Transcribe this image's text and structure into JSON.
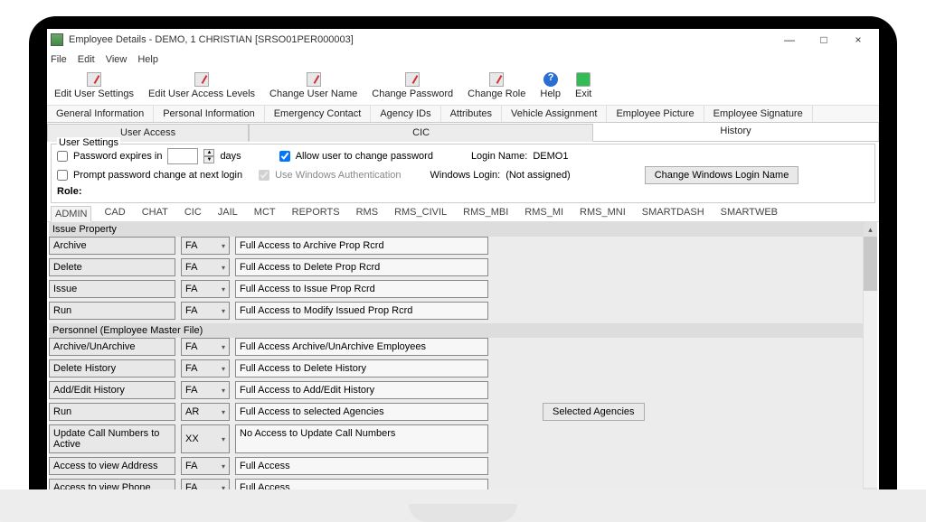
{
  "window": {
    "title": "Employee Details - DEMO, 1 CHRISTIAN [SRSO01PER000003]",
    "minimize": "—",
    "maximize": "□",
    "close": "×"
  },
  "menubar": {
    "items": [
      "File",
      "Edit",
      "View",
      "Help"
    ]
  },
  "toolbar": {
    "items": [
      {
        "label": "Edit User Settings"
      },
      {
        "label": "Edit User Access Levels"
      },
      {
        "label": "Change User Name"
      },
      {
        "label": "Change Password"
      },
      {
        "label": "Change Role"
      },
      {
        "label": "Help"
      },
      {
        "label": "Exit"
      }
    ]
  },
  "primary_tabs": [
    "General Information",
    "Personal Information",
    "Emergency Contact",
    "Agency IDs",
    "Attributes",
    "Vehicle Assignment",
    "Employee Picture",
    "Employee Signature"
  ],
  "secondary_tabs": {
    "left": "User Access",
    "mid": "CIC",
    "right": "History"
  },
  "user_settings": {
    "legend": "User Settings",
    "pw_expires_label_a": "Password expires in",
    "pw_expires_label_b": "days",
    "pw_expires_value": "",
    "allow_change_pw": "Allow user to change password",
    "prompt_change": "Prompt password change at next login",
    "win_auth": "Use Windows Authentication",
    "login_name_label": "Login Name:",
    "login_name_value": "DEMO1",
    "win_login_label": "Windows Login:",
    "win_login_value": "(Not assigned)",
    "change_win_login_btn": "Change Windows Login Name",
    "role_label": "Role:"
  },
  "role_tabs": [
    "ADMIN",
    "CAD",
    "CHAT",
    "CIC",
    "JAIL",
    "MCT",
    "REPORTS",
    "RMS",
    "RMS_CIVIL",
    "RMS_MBI",
    "RMS_MI",
    "RMS_MNI",
    "SMARTDASH",
    "SMARTWEB"
  ],
  "sections": [
    {
      "title": "Issue Property",
      "rows": [
        {
          "name": "Archive",
          "code": "FA",
          "desc": "Full Access to Archive Prop Rcrd"
        },
        {
          "name": "Delete",
          "code": "FA",
          "desc": "Full Access to Delete  Prop Rcrd"
        },
        {
          "name": "Issue",
          "code": "FA",
          "desc": "Full Access to Issue Prop Rcrd"
        },
        {
          "name": "Run",
          "code": "FA",
          "desc": "Full Access to Modify  Issued Prop Rcrd"
        }
      ]
    },
    {
      "title": "Personnel (Employee Master File)",
      "rows": [
        {
          "name": "Archive/UnArchive",
          "code": "FA",
          "desc": "Full Access Archive/UnArchive Employees"
        },
        {
          "name": "Delete History",
          "code": "FA",
          "desc": "Full Access to Delete History"
        },
        {
          "name": "Add/Edit History",
          "code": "FA",
          "desc": "Full Access to Add/Edit History"
        },
        {
          "name": "Run",
          "code": "AR",
          "desc": "Full Access to selected Agencies",
          "button": "Selected Agencies"
        },
        {
          "name": "Update Call Numbers to Active",
          "code": "XX",
          "desc": "No Access to Update Call Numbers"
        },
        {
          "name": "Access to view Address",
          "code": "FA",
          "desc": "Full Access"
        },
        {
          "name": "Access to view Phone",
          "code": "FA",
          "desc": "Full Access"
        }
      ]
    }
  ]
}
